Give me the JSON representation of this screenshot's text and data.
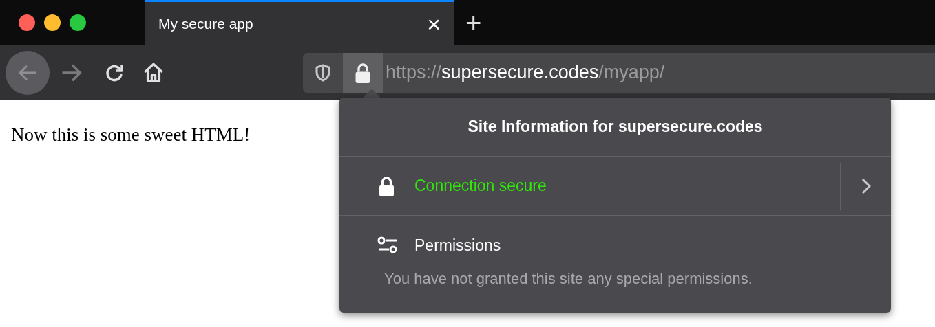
{
  "window_controls": [
    {
      "color": "#fe5f57"
    },
    {
      "color": "#febc2e"
    },
    {
      "color": "#28c840"
    }
  ],
  "tabs": [
    {
      "title": "My secure app",
      "selected": true,
      "close": "×"
    }
  ],
  "new_tab": "+",
  "toolbar": {
    "back_disabled": false,
    "forward_disabled": true
  },
  "url": [
    {
      "text": "https://",
      "emphasis": false
    },
    {
      "text": "supersecure.codes",
      "emphasis": true
    },
    {
      "text": "/myapp/",
      "emphasis": false
    }
  ],
  "page": {
    "text": "Now this is some sweet HTML!"
  },
  "popup": {
    "title": "Site Information for supersecure.codes",
    "connection": {
      "label": "Connection secure",
      "secure": true
    },
    "permissions": {
      "label": "Permissions",
      "note": "You have not granted this site any special permissions."
    }
  }
}
